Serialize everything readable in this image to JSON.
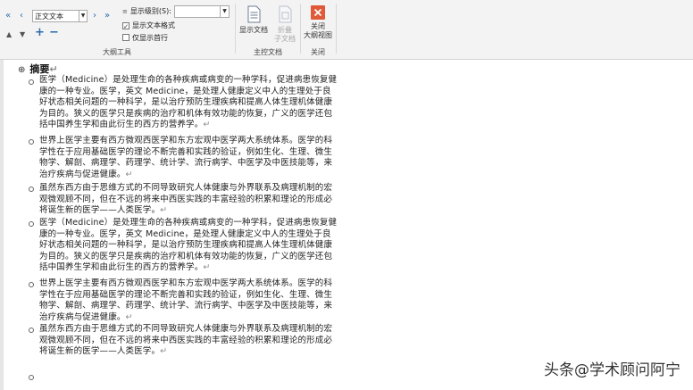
{
  "toolbar": {
    "level_value": "正文文本",
    "show_level_label": "显示级别(S):",
    "show_text_format_label": "显示文本格式",
    "show_first_line_label": "仅显示首行",
    "group_outline_tools": "大纲工具",
    "show_document_label": "显示文档",
    "collapse_subdoc_label_1": "折叠",
    "collapse_subdoc_label_2": "子文档",
    "group_master_document": "主控文档",
    "close_outline_label_1": "关闭",
    "close_outline_label_2": "大纲视图",
    "group_close": "关闭"
  },
  "document": {
    "heading": "摘要",
    "paragraphs": [
      "医学（Medicine）是处理生命的各种疾病或病变的一种学科，促进病患恢复健康的一种专业。医学，英文 Medicine，是处理人健康定义中人的生理处于良好状态相关问题的一种科学，是以治疗预防生理疾病和提高人体生理机体健康为目的。狭义的医学只是疾病的治疗和机体有效功能的恢复，广义的医学还包括中国养生学和由此衍生的西方的营养学。",
      "世界上医学主要有西方微观西医学和东方宏观中医学两大系统体系。医学的科学性在于应用基础医学的理论不断完善和实践的验证，例如生化、生理、微生物学、解剖、病理学、药理学、统计学、流行病学、中医学及中医技能等，来治疗疾病与促进健康。",
      "虽然东西方由于思维方式的不同导致研究人体健康与外界联系及病理机制的宏观微观顾不同，但在不远的将来中西医实践的丰富经验的积累和理论的形成必将诞生新的医学——人类医学。",
      "医学（Medicine）是处理生命的各种疾病或病变的一种学科，促进病患恢复健康的一种专业。医学，英文 Medicine，是处理人健康定义中人的生理处于良好状态相关问题的一种科学，是以治疗预防生理疾病和提高人体生理机体健康为目的。狭义的医学只是疾病的治疗和机体有效功能的恢复，广义的医学还包括中国养生学和由此衍生的西方的营养学。",
      "世界上医学主要有西方微观西医学和东方宏观中医学两大系统体系。医学的科学性在于应用基础医学的理论不断完善和实践的验证，例如生化、生理、微生物学、解剖、病理学、药理学、统计学、流行病学、中医学及中医技能等，来治疗疾病与促进健康。",
      "虽然东西方由于思维方式的不同导致研究人体健康与外界联系及病理机制的宏观微观顾不同，但在不远的将来中西医实践的丰富经验的积累和理论的形成必将诞生新的医学——人类医学。"
    ],
    "para_mark": "↵"
  },
  "watermark": "头条@学术顾问阿宁",
  "colors": {
    "accent_blue": "#2b6cb0",
    "close_red": "#e05a3a"
  }
}
